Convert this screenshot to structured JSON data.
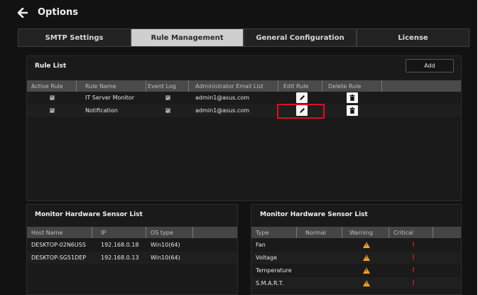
{
  "window": {
    "title": "Options"
  },
  "tabs": [
    {
      "label": "SMTP Settings",
      "active": false
    },
    {
      "label": "Rule Management",
      "active": true
    },
    {
      "label": "General Configuration",
      "active": false
    },
    {
      "label": "License",
      "active": false
    }
  ],
  "rule_list": {
    "title": "Rule List",
    "add_label": "Add",
    "columns": [
      "Active Rule",
      "Rule Name",
      "Event Log",
      "Administrator Email List",
      "Edit Rule",
      "Delete Rule"
    ],
    "rows": [
      {
        "active": true,
        "name": "IT Server Monitor",
        "event_log": true,
        "email": "admin1@asus.com"
      },
      {
        "active": true,
        "name": "Notification",
        "event_log": true,
        "email": "admin1@asus.com"
      }
    ]
  },
  "hosts_panel": {
    "title": "Monitor Hardware Sensor List",
    "columns": [
      "Host Name",
      "IP",
      "OS type"
    ],
    "rows": [
      {
        "host": "DESKTOP-02N6USS",
        "ip": "192.168.0.18",
        "os": "Win10(64)"
      },
      {
        "host": "DESKTOP-SG51DEP",
        "ip": "192.168.0.13",
        "os": "Win10(64)"
      }
    ]
  },
  "sensor_panel": {
    "title": "Monitor Hardware Sensor List",
    "columns": [
      "Type",
      "Normal",
      "Warning",
      "Critical"
    ],
    "rows": [
      {
        "type": "Fan"
      },
      {
        "type": "Voltage"
      },
      {
        "type": "Temperature"
      },
      {
        "type": "S.M.A.R.T."
      }
    ]
  },
  "colors": {
    "highlight": "#e01020",
    "warning": "#f5a020",
    "critical": "#e01c1c"
  },
  "icons": {
    "back": "arrow-left-icon",
    "edit": "pencil-icon",
    "delete": "trash-icon"
  }
}
